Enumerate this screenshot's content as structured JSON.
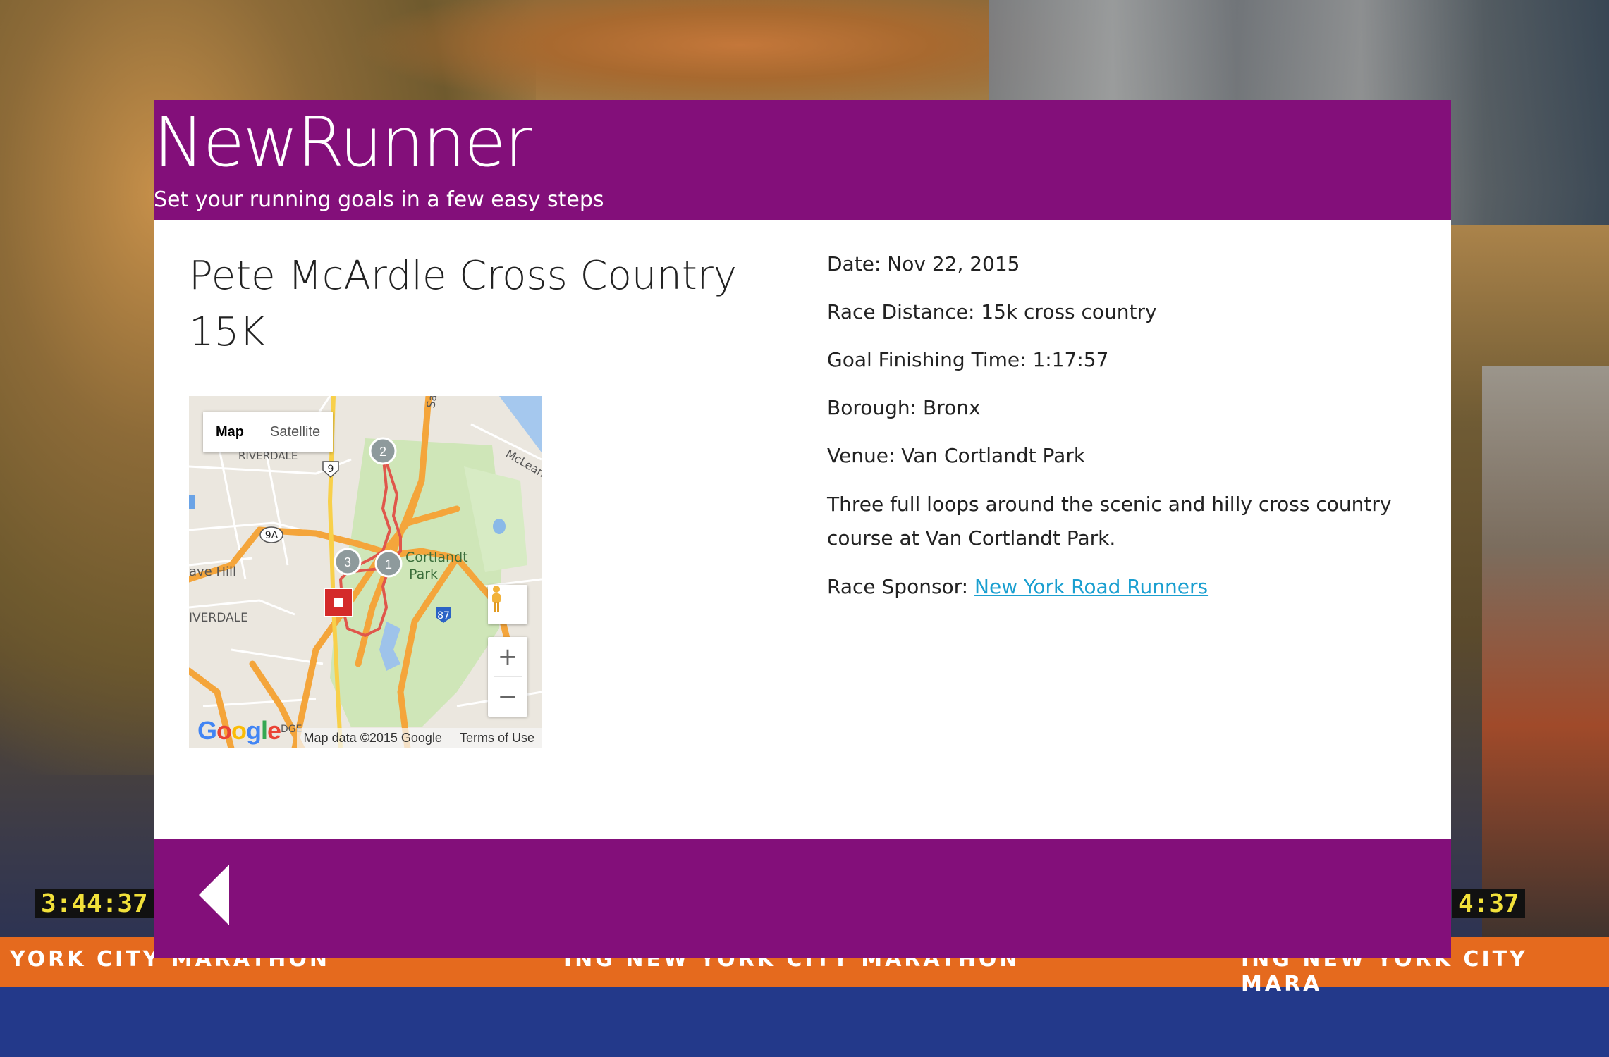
{
  "header": {
    "brand": "NewRunner",
    "tagline": "Set your running goals in a few easy steps"
  },
  "race": {
    "title": "Pete McArdle Cross Country 15K",
    "date_label": "Date:",
    "date": "Nov 22, 2015",
    "distance_label": "Race Distance:",
    "distance": "15k cross country",
    "goal_label": "Goal Finishing Time:",
    "goal_time": "1:17:57",
    "borough_label": "Borough:",
    "borough": "Bronx",
    "venue_label": "Venue:",
    "venue": "Van Cortlandt Park",
    "description": "Three full loops around the scenic and hilly cross country course at Van Cortlandt Park.",
    "sponsor_label": "Race Sponsor:",
    "sponsor": "New York Road Runners"
  },
  "map": {
    "type_options": [
      "Map",
      "Satellite"
    ],
    "selected_type": "Map",
    "zoom_in": "+",
    "zoom_out": "−",
    "attribution": "Map data ©2015 Google",
    "terms": "Terms of Use",
    "google_logo": "Google",
    "labels": {
      "riverdale": "RIVERDALE",
      "riverdale2": "IVERDALE",
      "fieldston": "ave Hill",
      "cortlandt": "Cortlandt",
      "park": "Park",
      "mclean": "McLean",
      "saw": "Saw",
      "route9": "9",
      "route9a": "9A",
      "i87": "87",
      "edge": "DGE"
    },
    "markers": [
      "1",
      "2",
      "3"
    ]
  },
  "background": {
    "banner_text": "YORK CITY MARATHON",
    "banner_text2": "ING NEW YORK CITY MARATHON",
    "banner_text3": "ING NEW YORK CITY MARA",
    "clock_left": "3:44:37",
    "clock_right": "4:37"
  },
  "colors": {
    "header": "#830f7a",
    "link": "#1a9fd0",
    "route": "#e0564b"
  }
}
